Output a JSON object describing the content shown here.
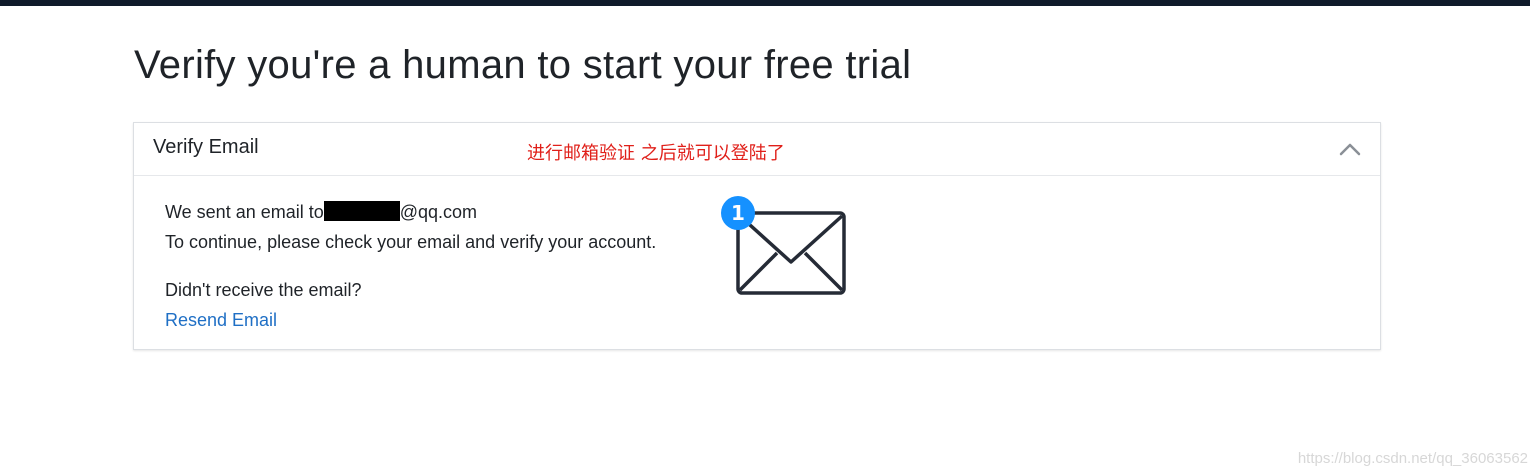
{
  "page": {
    "title": "Verify you're a human to start your free trial"
  },
  "card": {
    "title": "Verify Email",
    "annotation": "进行邮箱验证 之后就可以登陆了",
    "sent_prefix": "We sent an email to",
    "email_domain": "@qq.com",
    "instruction": "To continue, please check your email and verify your account.",
    "not_received": "Didn't receive the email?",
    "resend_label": "Resend Email",
    "badge_count": "1"
  },
  "icons": {
    "collapse": "chevron-up-icon",
    "envelope": "envelope-icon"
  },
  "colors": {
    "top_bar": "#0f1a2a",
    "link": "#1f6fc5",
    "annotation": "#e0201a",
    "badge": "#1591ff"
  },
  "watermark": "https://blog.csdn.net/qq_36063562"
}
